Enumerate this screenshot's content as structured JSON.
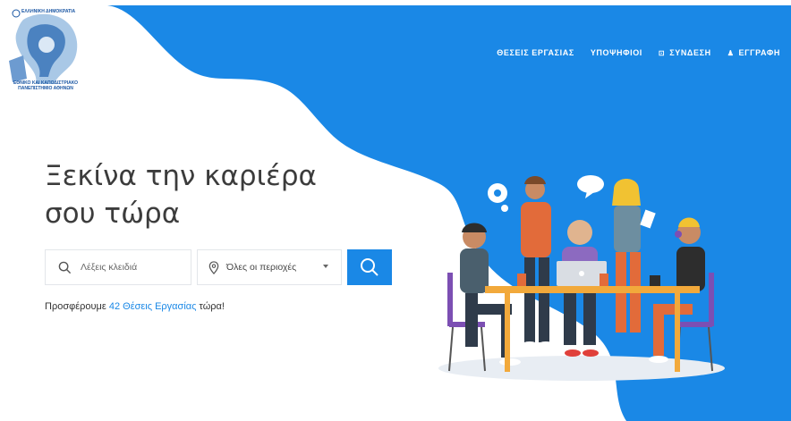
{
  "colors": {
    "accent": "#1a88e6",
    "background_blue": "#1a88e6"
  },
  "logo": {
    "top_text": "ΕΛΛΗΝΙΚΗ ΔΗΜΟΚΡΑΤΙΑ",
    "bottom_line1": "ΕΘΝΙΚΟ ΚΑΙ ΚΑΠΟΔΙΣΤΡΙΑΚΟ",
    "bottom_line2": "ΠΑΝΕΠΙΣΤΗΜΙΟ ΑΘΗΝΩΝ"
  },
  "nav": {
    "items": [
      {
        "label": "ΘΕΣΕΙΣ ΕΡΓΑΣΙΑΣ",
        "icon": ""
      },
      {
        "label": "ΥΠΟΨΗΦΙΟΙ",
        "icon": ""
      },
      {
        "label": "ΣΥΝΔΕΣΗ",
        "icon": "login-icon"
      },
      {
        "label": "ΕΓΓΡΑΦΗ",
        "icon": "user-icon"
      }
    ]
  },
  "hero": {
    "title_line1": "Ξεκίνα την καριέρα",
    "title_line2": "σου τώρα"
  },
  "search": {
    "keywords_placeholder": "Λέξεις κλειδιά",
    "keywords_value": "",
    "location_selected": "Όλες οι περιοχές",
    "search_icon": "search-icon",
    "location_icon": "map-pin-icon"
  },
  "offer": {
    "prefix": "Προσφέρουμε",
    "link": "42 Θέσεις Εργασίας",
    "suffix": "τώρα!"
  }
}
